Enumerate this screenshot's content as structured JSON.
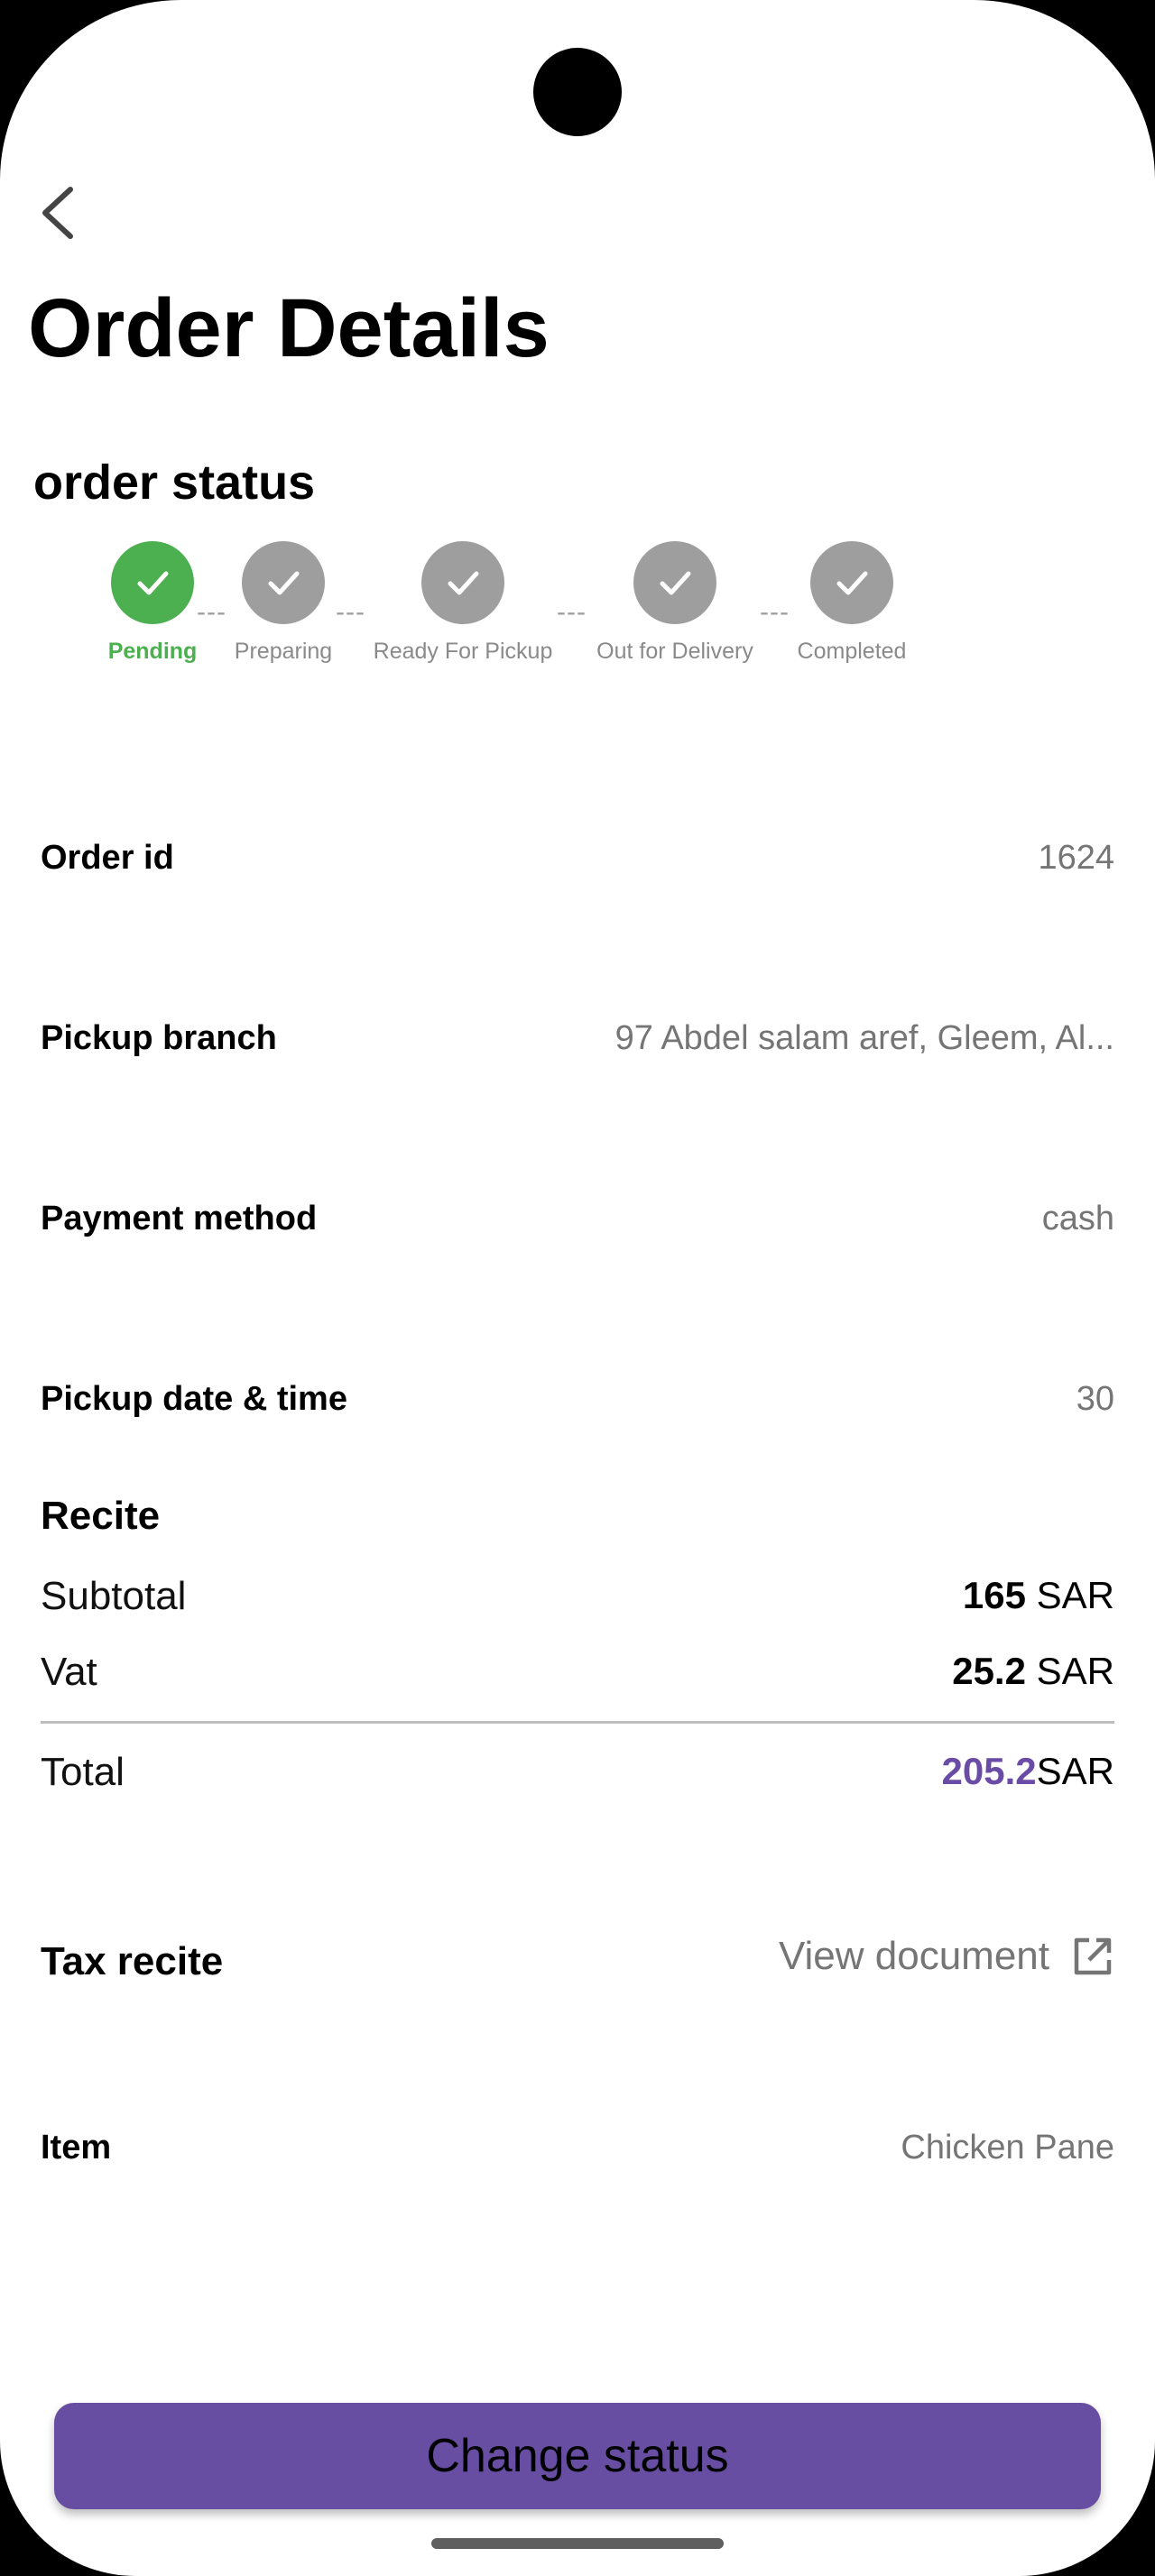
{
  "header": {
    "title": "Order Details",
    "back_icon": "back-arrow-icon"
  },
  "order_status": {
    "title": "order status",
    "colors": {
      "active": "#4caf50",
      "inactive": "#9e9e9e"
    },
    "separator": "---",
    "steps": [
      {
        "label": "Pending",
        "state": "active"
      },
      {
        "label": "Preparing",
        "state": "inactive"
      },
      {
        "label": "Ready For Pickup",
        "state": "inactive"
      },
      {
        "label": "Out for Delivery",
        "state": "inactive"
      },
      {
        "label": "Completed",
        "state": "inactive"
      }
    ]
  },
  "details": [
    {
      "label": "Order id",
      "value": "1624"
    },
    {
      "label": "Pickup branch",
      "value": "97 Abdel salam aref, Gleem, Al..."
    },
    {
      "label": "Payment method",
      "value": "cash"
    },
    {
      "label": "Pickup date & time",
      "value": "30"
    }
  ],
  "recite": {
    "title": "Recite",
    "currency": "SAR",
    "subtotal": {
      "label": "Subtotal",
      "value": "165"
    },
    "vat": {
      "label": "Vat",
      "value": "25.2"
    },
    "total": {
      "label": "Total",
      "value": "205.2",
      "color": "#6a4ca6"
    }
  },
  "tax_recite": {
    "label": "Tax recite",
    "link_text": "View document",
    "link_icon": "open-external-icon"
  },
  "item": {
    "label": "Item",
    "value": "Chicken Pane"
  },
  "actions": {
    "change_status_label": "Change status",
    "button_color": "#684ea3"
  }
}
